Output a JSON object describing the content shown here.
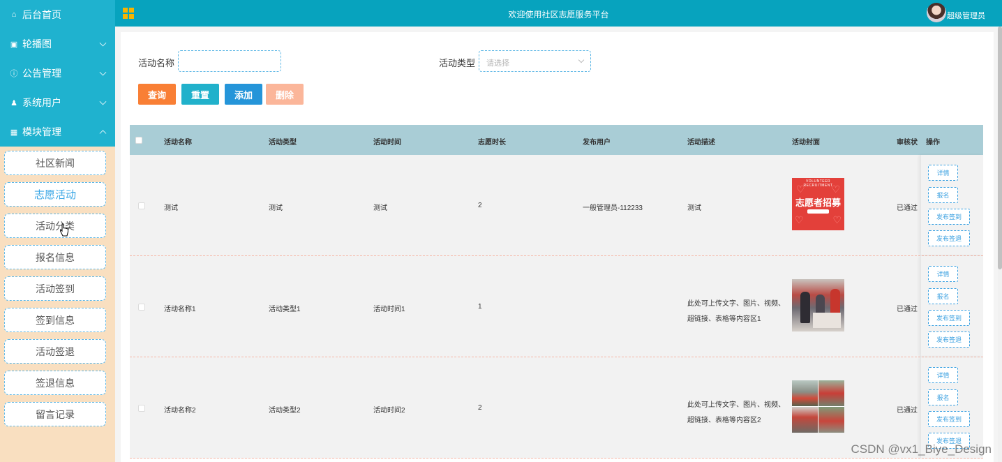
{
  "sidebar": {
    "nav": [
      {
        "label": "后台首页",
        "icon": "home-icon",
        "glyph": "⌂"
      },
      {
        "label": "轮播图",
        "icon": "image-icon",
        "glyph": "▣"
      },
      {
        "label": "公告管理",
        "icon": "info-icon",
        "glyph": "ⓘ"
      },
      {
        "label": "系统用户",
        "icon": "user-icon",
        "glyph": "♟"
      },
      {
        "label": "模块管理",
        "icon": "grid-icon",
        "glyph": "▦"
      }
    ],
    "submenu": [
      "社区新闻",
      "志愿活动",
      "活动分类",
      "报名信息",
      "活动签到",
      "签到信息",
      "活动签退",
      "签退信息",
      "留言记录"
    ],
    "active_sub": "志愿活动"
  },
  "header": {
    "title": "欢迎使用社区志愿服务平台",
    "user": "超级管理员"
  },
  "search": {
    "name_label": "活动名称",
    "name_value": "",
    "type_label": "活动类型",
    "type_placeholder": "请选择"
  },
  "buttons": {
    "query": "查询",
    "reset": "重置",
    "add": "添加",
    "delete": "删除"
  },
  "colors": {
    "header_bg": "#07a3be",
    "nav_bg": "#1fb2cf",
    "sidebar_bg": "#f9dfc0",
    "table_header_bg": "#a9cdd6",
    "query_btn": "#f97f35",
    "reset_btn": "#21b1cb",
    "add_btn": "#2595d9",
    "delete_btn": "#fbb69a"
  },
  "table": {
    "headers": [
      "活动名称",
      "活动类型",
      "活动时间",
      "志愿时长",
      "发布用户",
      "活动描述",
      "活动封面",
      "审核状",
      "操作"
    ],
    "rows": [
      {
        "name": "测试",
        "type": "测试",
        "time": "测试",
        "hours": "2",
        "publisher": "一般管理员-112233",
        "desc": "测试",
        "status": "已通过"
      },
      {
        "name": "活动名称1",
        "type": "活动类型1",
        "time": "活动时间1",
        "hours": "1",
        "publisher": "",
        "desc": "此处可上传文字、图片、视频、超链接、表格等内容区1",
        "status": "已通过"
      },
      {
        "name": "活动名称2",
        "type": "活动类型2",
        "time": "活动时间2",
        "hours": "2",
        "publisher": "",
        "desc": "此处可上传文字、图片、视频、超链接、表格等内容区2",
        "status": "已通过"
      }
    ],
    "cover1": {
      "top": "VOLUNTEER RECRUITMENT",
      "main": "志愿者招募"
    },
    "ops": {
      "detail": "详情",
      "signup": "报名",
      "checkin": "发布签到",
      "checkout": "发布签退"
    }
  },
  "watermark": "CSDN @vx1_Biye_Design"
}
